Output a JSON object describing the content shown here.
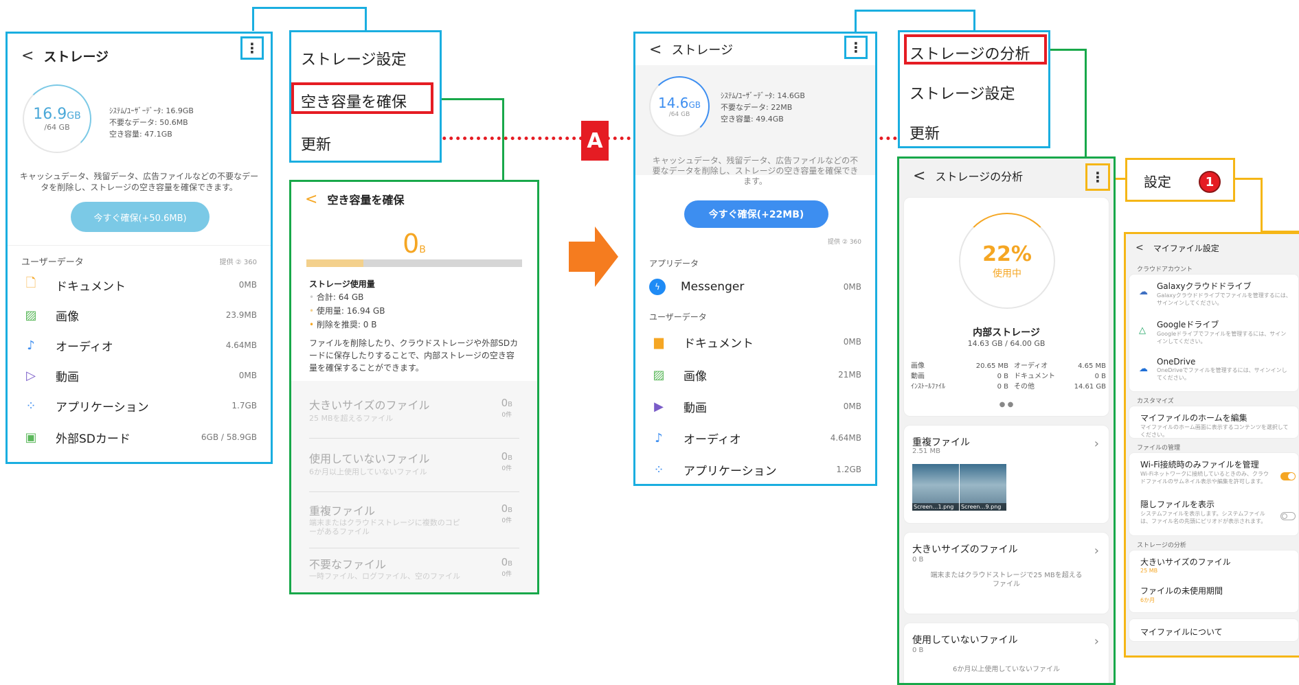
{
  "panel1": {
    "title": "ストレージ",
    "circle_value": "16.9",
    "circle_unit": "GB",
    "circle_total": "/64 GB",
    "details": [
      "ｼｽﾃﾑ/ﾕｰｻﾞｰﾃﾞｰﾀ: 16.9GB",
      "不要なデータ: 50.6MB",
      "空き容量: 47.1GB"
    ],
    "desc": "キャッシュデータ、残留データ、広告ファイルなどの不要なデータを削除し、ストレージの空き容量を確保できます。",
    "free_button": "今すぐ確保(+50.6MB)",
    "section": "ユーザーデータ",
    "provided": "提供 ② 360",
    "items": [
      {
        "label": "ドキュメント",
        "size": "0MB"
      },
      {
        "label": "画像",
        "size": "23.9MB"
      },
      {
        "label": "オーディオ",
        "size": "4.64MB"
      },
      {
        "label": "動画",
        "size": "0MB"
      },
      {
        "label": "アプリケーション",
        "size": "1.7GB"
      },
      {
        "label": "外部SDカード",
        "size": "6GB / 58.9GB"
      }
    ]
  },
  "menu1": {
    "items": [
      "ストレージ設定",
      "空き容量を確保",
      "更新"
    ]
  },
  "panel2": {
    "title": "空き容量を確保",
    "big": "0",
    "big_unit": "B",
    "usage_title": "ストレージ使用量",
    "usage": [
      "合計: 64 GB",
      "使用量: 16.94 GB",
      "削除を推奨: 0 B"
    ],
    "desc": "ファイルを削除したり、クラウドストレージや外部SDカードに保存したりすることで、内部ストレージの空き容量を確保することができます。",
    "items": [
      {
        "title": "大きいサイズのファイル",
        "sub": "25 MBを超えるファイル",
        "size": "0",
        "unit": "B",
        "count": "0件"
      },
      {
        "title": "使用していないファイル",
        "sub": "6か月以上使用していないファイル",
        "size": "0",
        "unit": "B",
        "count": "0件"
      },
      {
        "title": "重複ファイル",
        "sub": "端末またはクラウドストレージに複数のコピーがあるファイル",
        "size": "0",
        "unit": "B",
        "count": "0件"
      },
      {
        "title": "不要なファイル",
        "sub": "一時ファイル、ログファイル、空のファイル",
        "size": "0",
        "unit": "B",
        "count": "0件"
      }
    ]
  },
  "label_a": "A",
  "panel3": {
    "title": "ストレージ",
    "circle_value": "14.6",
    "circle_unit": "GB",
    "circle_total": "/64 GB",
    "details": [
      "ｼｽﾃﾑ/ﾕｰｻﾞｰﾃﾞｰﾀ: 14.6GB",
      "不要なデータ: 22MB",
      "空き容量: 49.4GB"
    ],
    "desc": "キャッシュデータ、残留データ、広告ファイルなどの不要なデータを削除し、ストレージの空き容量を確保できます。",
    "free_button": "今すぐ確保(+22MB)",
    "provided": "提供 ② 360",
    "app_section": "アプリデータ",
    "app_items": [
      {
        "label": "Messenger",
        "size": "0MB"
      }
    ],
    "user_section": "ユーザーデータ",
    "items": [
      {
        "label": "ドキュメント",
        "size": "0MB"
      },
      {
        "label": "画像",
        "size": "21MB"
      },
      {
        "label": "動画",
        "size": "0MB"
      },
      {
        "label": "オーディオ",
        "size": "4.64MB"
      },
      {
        "label": "アプリケーション",
        "size": "1.2GB"
      }
    ]
  },
  "menu2": {
    "items": [
      "ストレージの分析",
      "ストレージ設定",
      "更新"
    ]
  },
  "panel4": {
    "title": "ストレージの分析",
    "percent": "22%",
    "percent_label": "使用中",
    "internal": "内部ストレージ",
    "internal_sub": "14.63 GB / 64.00 GB",
    "stats_left": [
      [
        "画像",
        "20.65 MB"
      ],
      [
        "動画",
        "0 B"
      ],
      [
        "ｲﾝｽﾄｰﾙﾌｧｲﾙ",
        "0 B"
      ]
    ],
    "stats_right": [
      [
        "オーディオ",
        "4.65 MB"
      ],
      [
        "ドキュメント",
        "0 B"
      ],
      [
        "その他",
        "14.61 GB"
      ]
    ],
    "dup_title": "重複ファイル",
    "dup_size": "2.51 MB",
    "thumbs": [
      "Screen…1.png",
      "Screen…9.png"
    ],
    "large_title": "大きいサイズのファイル",
    "large_size": "0 B",
    "large_desc": "端末またはクラウドストレージで25 MBを超えるファイル",
    "unused_title": "使用していないファイル",
    "unused_size": "0 B",
    "unused_desc": "6か月以上使用していないファイル"
  },
  "settings_menu": {
    "label": "設定",
    "badge": "1"
  },
  "panel5": {
    "title": "マイファイル設定",
    "cloud_section": "クラウドアカウント",
    "clouds": [
      {
        "title": "Galaxyクラウドドライブ",
        "desc": "Galaxyクラウドドライブでファイルを管理するには、サインインしてください。"
      },
      {
        "title": "Googleドライブ",
        "desc": "Googleドライブでファイルを管理するには、サインインしてください。"
      },
      {
        "title": "OneDrive",
        "desc": "OneDriveでファイルを管理するには、サインインしてください。"
      }
    ],
    "custom_section": "カスタマイズ",
    "custom_title": "マイファイルのホームを編集",
    "custom_desc": "マイファイルのホーム画面に表示するコンテンツを選択してください。",
    "manage_section": "ファイルの管理",
    "wifi_title": "Wi-Fi接続時のみファイルを管理",
    "wifi_desc": "Wi-Fiネットワークに接続しているときのみ、クラウドファイルのサムネイル表示や編集を許可します。",
    "hidden_title": "隠しファイルを表示",
    "hidden_desc": "システムファイルを表示します。システムファイルは、ファイル名の先頭にピリオドが表示されます。",
    "analysis_section": "ストレージの分析",
    "large_title": "大きいサイズのファイル",
    "large_val": "25 MB",
    "unused_title": "ファイルの未使用期間",
    "unused_val": "6か月",
    "about": "マイファイルについて"
  },
  "colors": {
    "blue": "#1aaee0",
    "green": "#18a84a",
    "yellow": "#f5b616",
    "red": "#e51c23",
    "orange": "#f57c1f",
    "accent": "#f5a623",
    "button_blue": "#3d8ef0",
    "button_light": "#7bc9e6"
  }
}
